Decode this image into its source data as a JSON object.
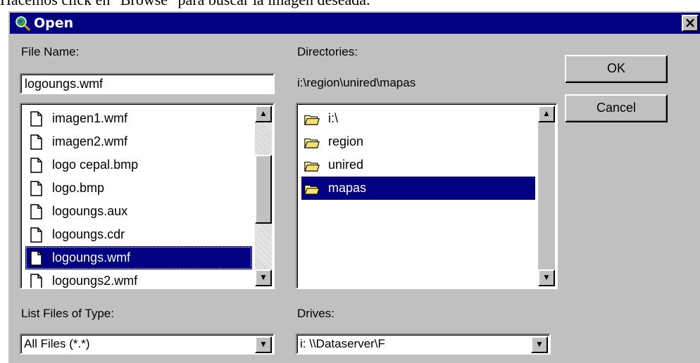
{
  "caption": "Hacemos click en \"Browse\" para buscar la imagen deseada.",
  "dialog": {
    "title": "Open",
    "close_label": "×",
    "file_name_label": "File Name:",
    "file_name_value": "logoungs.wmf",
    "files": [
      {
        "name": "imagen1.wmf"
      },
      {
        "name": "imagen2.wmf"
      },
      {
        "name": "logo cepal.bmp"
      },
      {
        "name": "logo.bmp"
      },
      {
        "name": "logoungs.aux"
      },
      {
        "name": "logoungs.cdr"
      },
      {
        "name": "logoungs.wmf",
        "selected": true
      },
      {
        "name": "logoungs2.wmf"
      }
    ],
    "directories_label": "Directories:",
    "current_path": "i:\\region\\unired\\mapas",
    "directories": [
      {
        "name": "i:\\"
      },
      {
        "name": "region"
      },
      {
        "name": "unired"
      },
      {
        "name": "mapas",
        "selected": true
      }
    ],
    "file_type_label": "List Files of Type:",
    "file_type_value": "All Files (*.*)",
    "drives_label": "Drives:",
    "drive_value": "i: \\\\Dataserver\\F",
    "ok_label": "OK",
    "cancel_label": "Cancel"
  }
}
